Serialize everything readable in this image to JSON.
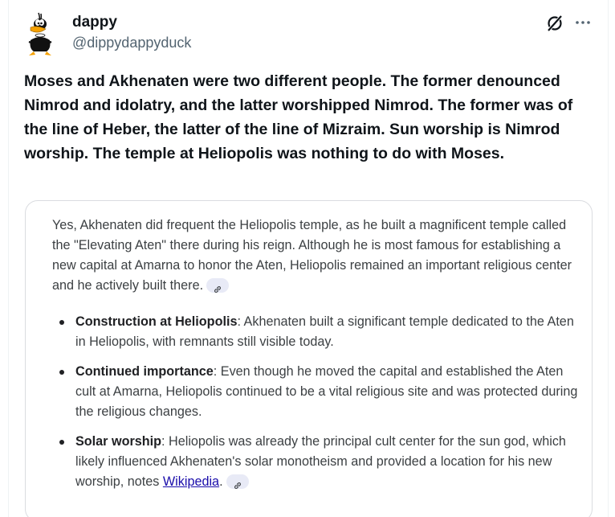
{
  "author": {
    "display_name": "dappy",
    "handle": "@dippydappyduck"
  },
  "icons": {
    "avatar": "daffy-duck-avatar",
    "grok": "grok-icon",
    "more": "more-options-icon",
    "citation": "link-icon"
  },
  "tweet": {
    "text": "Moses and Akhenaten were two different people. The former denounced Nimrod and idolatry, and the latter worshipped Nimrod. The former was of the line of Heber, the latter of the line of Mizraim. Sun worship is Nimrod worship. The temple at Heliopolis was nothing to do with Moses."
  },
  "embedded_answer": {
    "intro": "Yes, Akhenaten did frequent the Heliopolis temple, as he built a magnificent temple called the \"Elevating Aten\" there during his reign. Although he is most famous for establishing a new capital at Amarna to honor the Aten, Heliopolis remained an important religious center and he actively built there.",
    "bullets": [
      {
        "title": "Construction at Heliopolis",
        "text": ": Akhenaten built a significant temple dedicated to the Aten in Heliopolis, with remnants still visible today."
      },
      {
        "title": "Continued importance",
        "text": ": Even though he moved the capital and established the Aten cult at Amarna, Heliopolis continued to be a vital religious site and was protected during the religious changes."
      },
      {
        "title": "Solar worship",
        "text": ": Heliopolis was already the principal cult center for the sun god, which likely influenced Akhenaten's solar monotheism and provided a location for his new worship, notes ",
        "link": "Wikipedia",
        "after_link": "."
      }
    ]
  },
  "colors": {
    "text_primary": "#0f1419",
    "text_secondary": "#536471",
    "link": "#1a0dab",
    "chip_bg": "#e8eaf6"
  }
}
